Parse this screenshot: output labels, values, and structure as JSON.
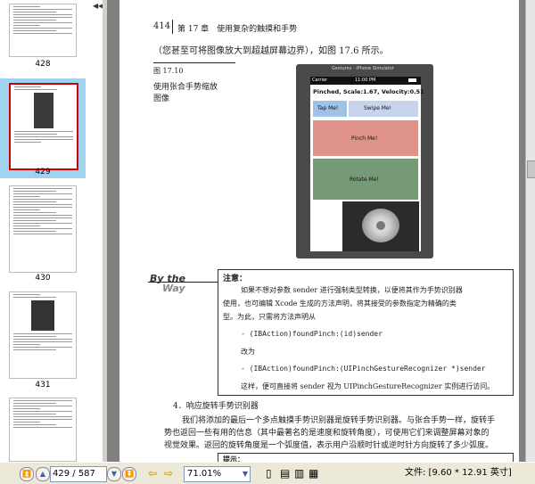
{
  "thumbnails": [
    {
      "label": "428"
    },
    {
      "label": "429"
    },
    {
      "label": "430"
    },
    {
      "label": "431"
    }
  ],
  "page": {
    "header_page_no": "414",
    "header_chapter": "第 17 章　使用复杂的触摸和手势",
    "intro_line": "（您甚至可将图像放大到超越屏幕边界），如图 17.6 所示。",
    "figure_no": "图 17.10",
    "figure_caption_1": "使用张合手势缩放",
    "figure_caption_2": "图像",
    "phone": {
      "window_title": "Gestures - iPhone Simulator",
      "carrier": "Carrier",
      "time": "11:00 PM",
      "status_text": "Pinched, Scale:1.67, Velocity:0.51",
      "tap_label": "Tap Me!",
      "swipe_label": "Swipe Me!",
      "pinch_label": "Pinch Me!",
      "rotate_label": "Rotate Me!"
    },
    "by_the_way_1": "By the",
    "by_the_way_2": "Way",
    "note_title": "注意：",
    "note_p1_l1": "如果不想对参数 sender 进行强制类型转换，以便将其作为手势识别器",
    "note_p1_l2": "使用，也可编辑 Xcode 生成的方法声明，将其接受的参数指定为精确的类",
    "note_p1_l3": "型。为此，只需将方法声明从",
    "code_1": "- (IBAction)foundPinch:(id)sender",
    "note_change": "改为",
    "code_2": "- (IBAction)foundPinch:(UIPinchGestureRecognizer *)sender",
    "note_p2": "这样，便可直接将 sender 视为 UIPinchGestureRecognizer 实例进行访问。",
    "section_title": "4．响应旋转手势识别器",
    "body_l1": "我们将添加的最后一个多点触摸手势识别器是旋转手势识别器。与张合手势一样，旋转手",
    "body_l2": "势也返回一些有用的信息（其中最著名的是速度和旋转角度），可使用它们来调整屏幕对象的",
    "body_l3": "视觉效果。返回的旋转角度是一个弧度值，表示用户沿顺时针或逆时针方向旋转了多少弧度。",
    "tip_title": "提示："
  },
  "statusbar": {
    "page_input": "429 / 587",
    "zoom": "71.01%",
    "file_info": "文件: [9.60 * 12.91 英寸]"
  },
  "colors": {
    "thumb_selected_bg": "#9fd3f0",
    "pinch_view": "#c94a3c",
    "rotate_view": "#3c6f3a",
    "tap_view": "#4e8fd6"
  }
}
